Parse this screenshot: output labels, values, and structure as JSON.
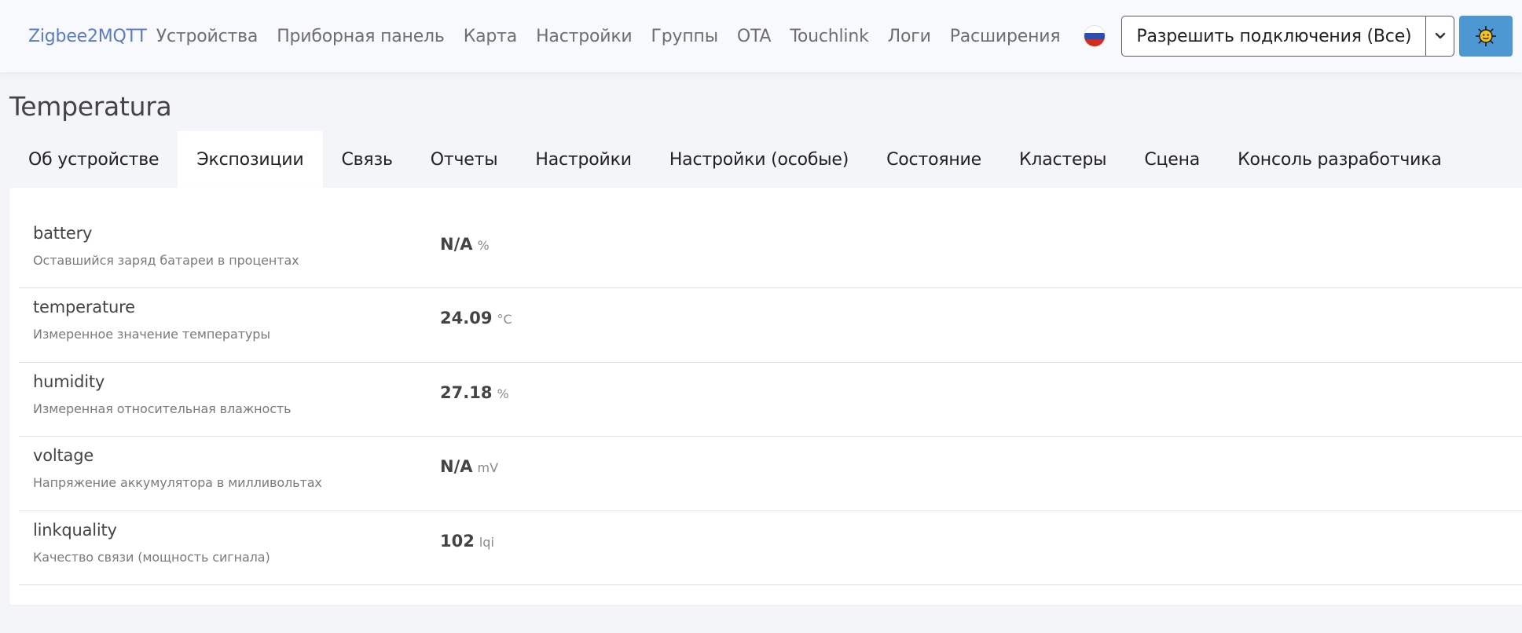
{
  "navbar": {
    "brand": "Zigbee2MQTT",
    "links": [
      "Устройства",
      "Приборная панель",
      "Карта",
      "Настройки",
      "Группы",
      "OTA",
      "Touchlink",
      "Логи",
      "Расширения"
    ],
    "language_flag": "russia-flag-icon",
    "permit_join_label": "Разрешить подключения (Все)",
    "theme_icon": "sun-icon"
  },
  "page": {
    "title": "Temperatura"
  },
  "tabs": [
    {
      "label": "Об устройстве",
      "active": false
    },
    {
      "label": "Экспозиции",
      "active": true
    },
    {
      "label": "Связь",
      "active": false
    },
    {
      "label": "Отчеты",
      "active": false
    },
    {
      "label": "Настройки",
      "active": false
    },
    {
      "label": "Настройки (особые)",
      "active": false
    },
    {
      "label": "Состояние",
      "active": false
    },
    {
      "label": "Кластеры",
      "active": false
    },
    {
      "label": "Сцена",
      "active": false
    },
    {
      "label": "Консоль разработчика",
      "active": false
    }
  ],
  "exposes": [
    {
      "name": "battery",
      "description": "Оставшийся заряд батареи в процентах",
      "value": "N/A",
      "unit": "%"
    },
    {
      "name": "temperature",
      "description": "Измеренное значение температуры",
      "value": "24.09",
      "unit": "°C"
    },
    {
      "name": "humidity",
      "description": "Измеренная относительная влажность",
      "value": "27.18",
      "unit": "%"
    },
    {
      "name": "voltage",
      "description": "Напряжение аккумулятора в милливольтах",
      "value": "N/A",
      "unit": "mV"
    },
    {
      "name": "linkquality",
      "description": "Качество связи (мощность сигнала)",
      "value": "102",
      "unit": "lqi"
    }
  ],
  "colors": {
    "brand": "#5b7cc4",
    "theme_button": "#4d98d3",
    "flag_white": "#ffffff",
    "flag_blue": "#2b4eb0",
    "flag_red": "#d52b1e"
  }
}
